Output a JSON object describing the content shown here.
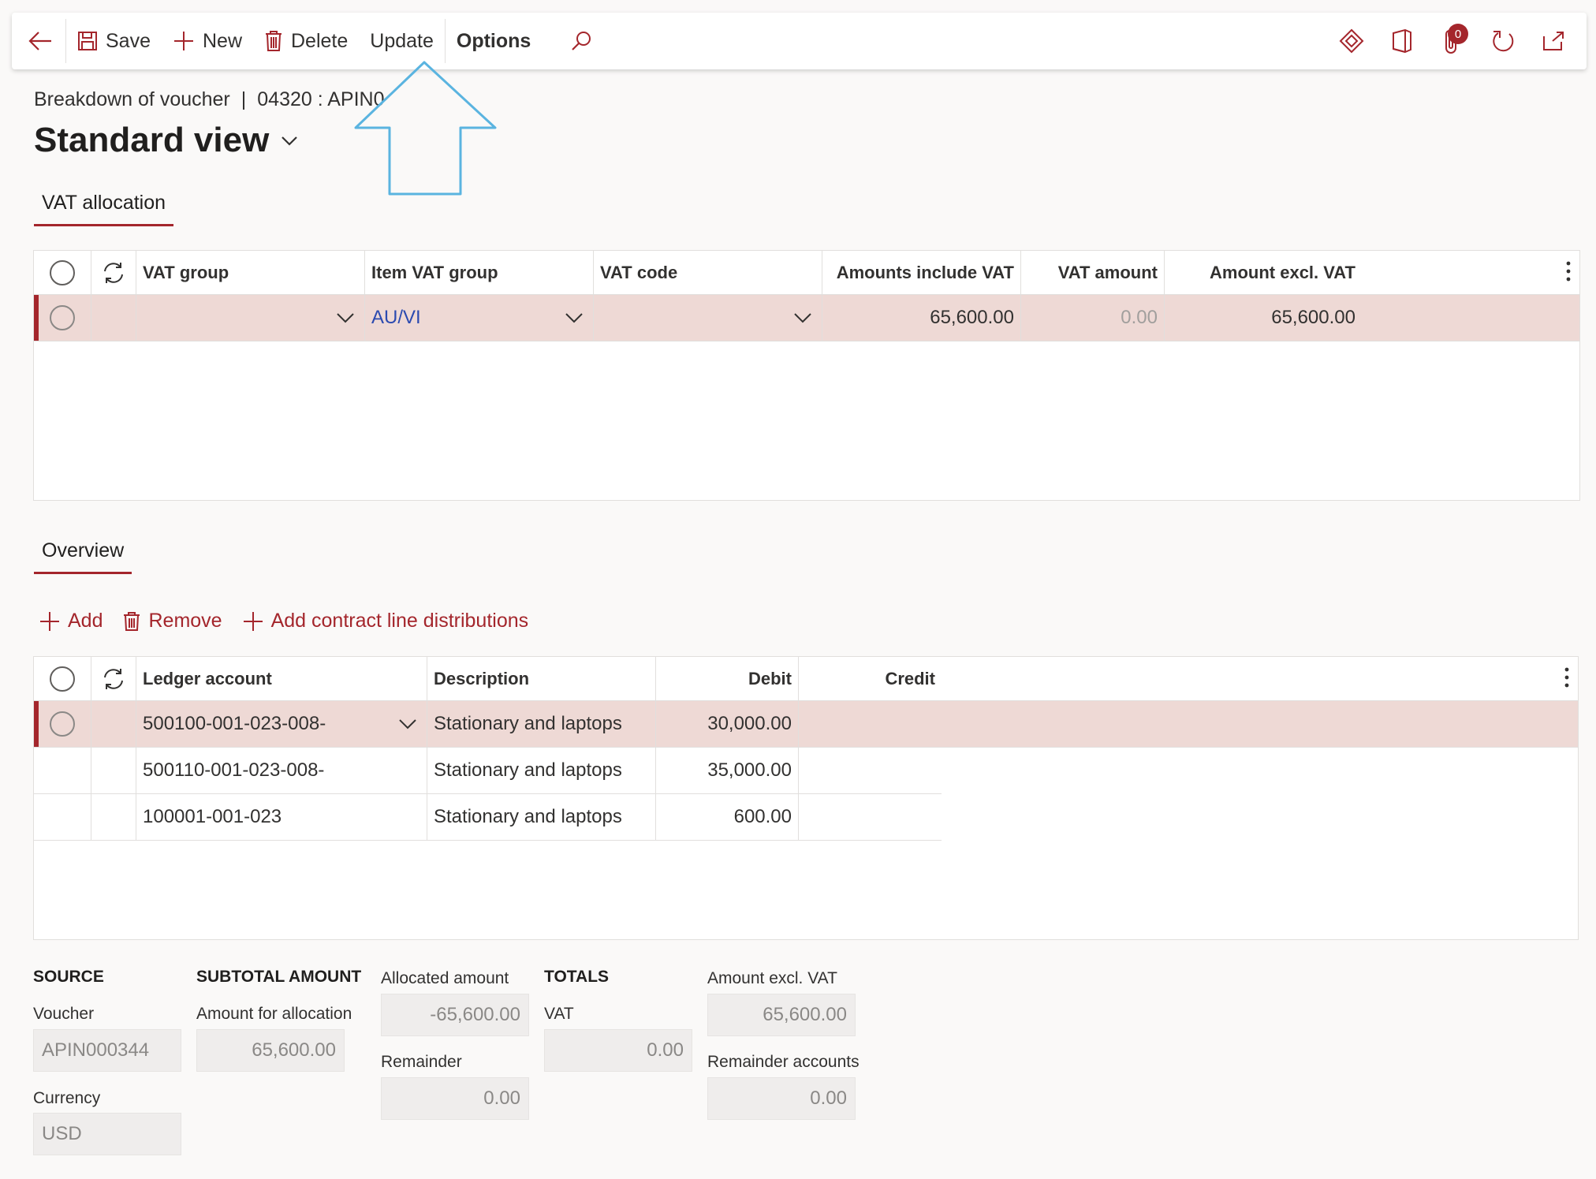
{
  "toolbar": {
    "save": "Save",
    "new": "New",
    "delete": "Delete",
    "update": "Update",
    "options": "Options",
    "notification_count": "0"
  },
  "header": {
    "breadcrumb_form": "Breakdown of voucher",
    "breadcrumb_separator": "|",
    "breadcrumb_record": "04320 : APIN0",
    "view_title": "Standard view"
  },
  "tabs": {
    "vat_allocation": "VAT allocation",
    "overview": "Overview"
  },
  "vat_grid": {
    "columns": [
      "VAT group",
      "Item VAT group",
      "VAT code",
      "Amounts include VAT",
      "VAT amount",
      "Amount excl. VAT"
    ],
    "rows": [
      {
        "vat_group": "",
        "item_vat_group": "AU/VI",
        "vat_code": "",
        "amounts_include_vat": "65,600.00",
        "vat_amount": "0.00",
        "amount_excl_vat": "65,600.00"
      }
    ]
  },
  "overview_actions": {
    "add": "Add",
    "remove": "Remove",
    "add_contract": "Add contract line distributions"
  },
  "ledger_grid": {
    "columns": [
      "Ledger account",
      "Description",
      "Debit",
      "Credit"
    ],
    "rows": [
      {
        "account": "500100-001-023-008-",
        "description": "Stationary and laptops",
        "debit": "30,000.00",
        "credit": ""
      },
      {
        "account": "500110-001-023-008-",
        "description": "Stationary and laptops",
        "debit": "35,000.00",
        "credit": ""
      },
      {
        "account": "100001-001-023",
        "description": "Stationary and laptops",
        "debit": "600.00",
        "credit": ""
      }
    ]
  },
  "footer": {
    "source": {
      "title": "SOURCE",
      "voucher_label": "Voucher",
      "voucher_value": "APIN000344",
      "currency_label": "Currency",
      "currency_value": "USD"
    },
    "subtotal": {
      "title": "SUBTOTAL AMOUNT",
      "amount_label": "Amount for allocation",
      "amount_value": "65,600.00"
    },
    "allocated": {
      "allocated_label": "Allocated amount",
      "allocated_value": "-65,600.00",
      "remainder_label": "Remainder",
      "remainder_value": "0.00"
    },
    "totals": {
      "title": "TOTALS",
      "vat_label": "VAT",
      "vat_value": "0.00"
    },
    "excl": {
      "excl_label": "Amount excl. VAT",
      "excl_value": "65,600.00",
      "remainder_accounts_label": "Remainder accounts",
      "remainder_accounts_value": "0.00"
    }
  },
  "colors": {
    "accent": "#a4262c",
    "selected_row": "#eed9d5",
    "link": "#2b4ab0",
    "annotation_arrow": "#5ab4e0"
  },
  "icons": {
    "back": "back-arrow-icon",
    "save": "save-icon",
    "new": "plus-icon",
    "delete": "trash-icon",
    "search": "search-icon",
    "diamond": "diamond-icon",
    "office": "office-icon",
    "attach": "attachment-icon",
    "refresh": "refresh-icon",
    "popout": "open-new-window-icon"
  }
}
